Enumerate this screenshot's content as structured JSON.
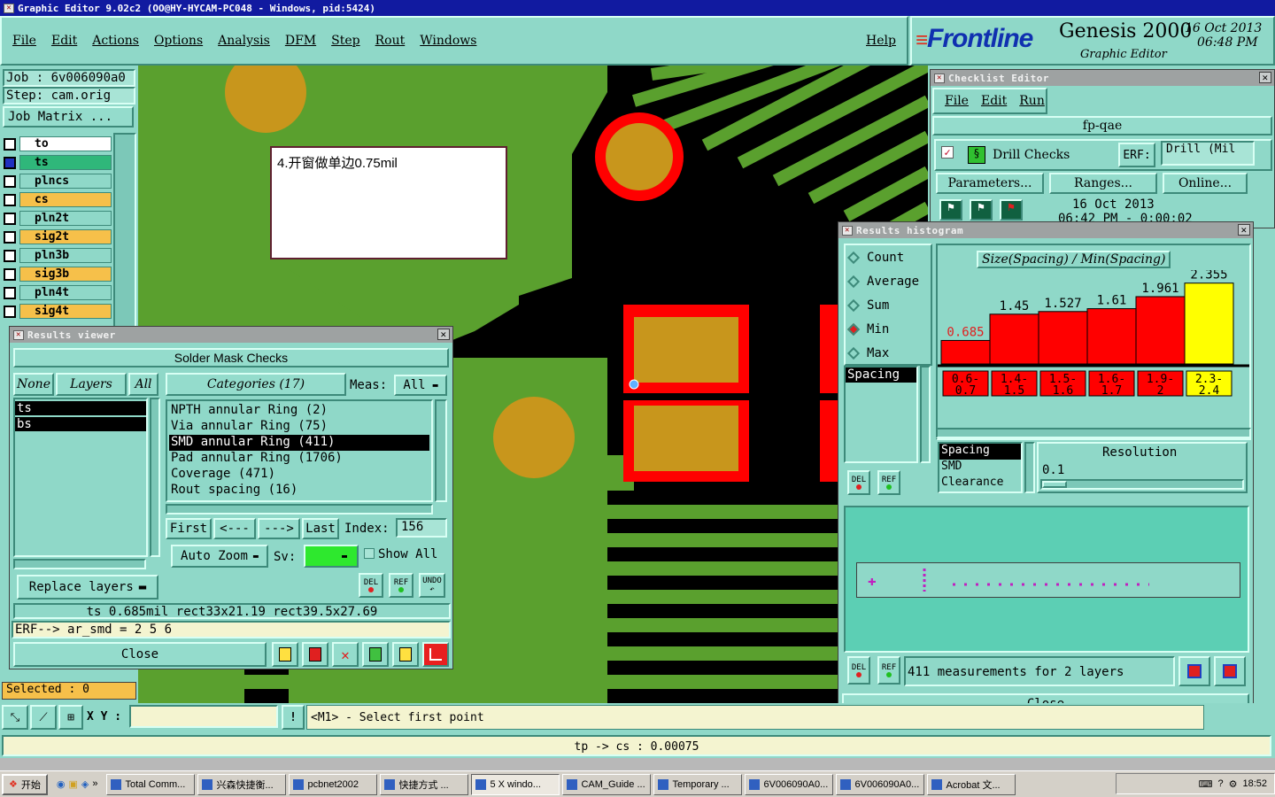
{
  "window": {
    "title": "Graphic Editor 9.02c2 (OO@HY-HYCAM-PC048 - Windows, pid:5424)"
  },
  "menubar": {
    "items": [
      "File",
      "Edit",
      "Actions",
      "Options",
      "Analysis",
      "DFM",
      "Step",
      "Rout",
      "Windows"
    ],
    "help": "Help"
  },
  "brand": {
    "logo": "Frontline",
    "product": "Genesis 2000",
    "subtitle": "Graphic Editor",
    "date": "16 Oct 2013",
    "time": "06:48 PM"
  },
  "job": {
    "job": "Job  :  6v006090a0",
    "step": "Step: cam.orig",
    "matrix_button": "Job Matrix ..."
  },
  "layers": [
    {
      "name": "to",
      "color": "#ffffff",
      "active": true
    },
    {
      "name": "ts",
      "color": "#2fb77a",
      "active": true
    },
    {
      "name": "plncs",
      "color": "#8fd8c8"
    },
    {
      "name": "cs",
      "color": "#f6c04a"
    },
    {
      "name": "pln2t",
      "color": "#8fd8c8"
    },
    {
      "name": "sig2t",
      "color": "#f6c04a"
    },
    {
      "name": "pln3b",
      "color": "#8fd8c8"
    },
    {
      "name": "sig3b",
      "color": "#f6c04a"
    },
    {
      "name": "pln4t",
      "color": "#8fd8c8"
    },
    {
      "name": "sig4t",
      "color": "#f6c04a"
    }
  ],
  "note": {
    "text": "4.开窗做单边0.75mil"
  },
  "results_viewer": {
    "title": "Results viewer",
    "heading": "Solder Mask Checks",
    "none": "None",
    "layers": "Layers",
    "all": "All",
    "layer_list": [
      "ts",
      "bs"
    ],
    "categories_label": "Categories (17)",
    "meas_label": "Meas:",
    "meas_value": "All",
    "categories": [
      "NPTH annular Ring (2)",
      "Via annular Ring (75)",
      "SMD annular Ring (411)",
      "Pad annular Ring (1706)",
      "Coverage (471)",
      "Rout spacing (16)"
    ],
    "selected_index": 2,
    "nav": {
      "first": "First",
      "prev": "<---",
      "next": "--->",
      "last": "Last",
      "index_label": "Index:",
      "index_value": "156"
    },
    "auto_zoom": "Auto Zoom",
    "sv_label": "Sv:",
    "show_all": "Show All",
    "replace_layers": "Replace layers",
    "del": "DEL",
    "ref": "REF",
    "undo": "UNDO",
    "status": "ts 0.685mil   rect33x21.19   rect39.5x27.69",
    "erf_line": "ERF--> ar_smd = 2 5 6",
    "close": "Close"
  },
  "checklist": {
    "title": "Checklist Editor",
    "menu": [
      "File",
      "Edit",
      "Run"
    ],
    "name": "fp-qae",
    "check": "Drill Checks",
    "erf_label": "ERF:",
    "erf_value": "Drill (Mil",
    "buttons": [
      "Parameters...",
      "Ranges...",
      "Online..."
    ],
    "date": "16 Oct 2013",
    "time": "06:42 PM - 0:00:02"
  },
  "histogram": {
    "title": "Results histogram",
    "options": [
      "Count",
      "Average",
      "Sum",
      "Min",
      "Max"
    ],
    "selected_option": "Min",
    "type_list": [
      "Spacing"
    ],
    "chart_title": "Size(Spacing) / Min(Spacing)",
    "sub_list": [
      "Spacing",
      "SMD",
      "Clearance"
    ],
    "resolution_label": "Resolution",
    "resolution_value": "0.1",
    "footer": "411 measurements for 2 layers",
    "close": "Close",
    "del": "DEL",
    "ref": "REF"
  },
  "chart_data": {
    "type": "bar",
    "categories": [
      "0.6-0.7",
      "1.4-1.5",
      "1.5-1.6",
      "1.6-1.7",
      "1.9-2",
      "2.3-2.4"
    ],
    "values": [
      0.685,
      1.45,
      1.527,
      1.61,
      1.961,
      2.355
    ],
    "value_labels": [
      "0.685",
      "1.45",
      "1.527",
      "1.61",
      "1.961",
      "2.355"
    ],
    "colors": [
      "#ff0000",
      "#ff0000",
      "#ff0000",
      "#ff0000",
      "#ff0000",
      "#ffff00"
    ],
    "title": "Size(Spacing) / Min(Spacing)",
    "ylim": [
      0,
      2.6
    ]
  },
  "bottom": {
    "selected": "Selected : 0",
    "xy_label": "X Y :",
    "prompt": "<M1> - Select first point",
    "status": "tp -> cs : 0.00075"
  },
  "taskbar": {
    "start": "开始",
    "items": [
      "Total Comm...",
      "兴森快捷衡...",
      "pcbnet2002",
      "快捷方式 ...",
      "5 X windo...",
      "CAM_Guide ...",
      "Temporary ...",
      "6V006090A0...",
      "6V006090A0...",
      "Acrobat 文..."
    ],
    "clock": "18:52"
  }
}
